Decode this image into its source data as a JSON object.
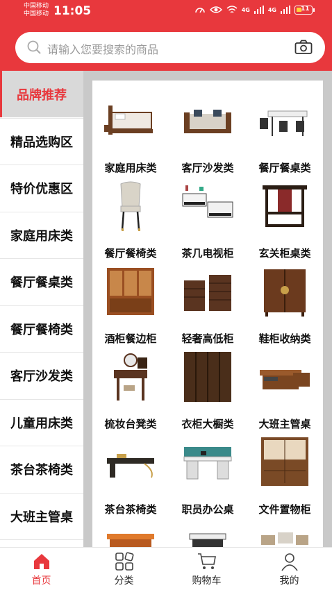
{
  "status": {
    "carrier1": "中国移动",
    "carrier2": "中国移动",
    "time": "11:05",
    "net1": "4G",
    "net2": "4G",
    "battery": "11"
  },
  "search": {
    "placeholder": "请输入您要搜索的商品"
  },
  "sidebar": {
    "items": [
      {
        "label": "品牌推荐",
        "active": true
      },
      {
        "label": "精品选购区"
      },
      {
        "label": "特价优惠区"
      },
      {
        "label": "家庭用床类"
      },
      {
        "label": "餐厅餐桌类"
      },
      {
        "label": "餐厅餐椅类"
      },
      {
        "label": "客厅沙发类"
      },
      {
        "label": "儿童用床类"
      },
      {
        "label": "茶台茶椅类"
      },
      {
        "label": "大班主管桌"
      },
      {
        "label": ""
      }
    ]
  },
  "products": [
    {
      "label": "家庭用床类",
      "icon": "bed-icon"
    },
    {
      "label": "客厅沙发类",
      "icon": "sofa-icon"
    },
    {
      "label": "餐厅餐桌类",
      "icon": "dining-table-icon"
    },
    {
      "label": "餐厅餐椅类",
      "icon": "chair-icon"
    },
    {
      "label": "茶几电视柜",
      "icon": "tv-cabinet-icon"
    },
    {
      "label": "玄关柜桌类",
      "icon": "console-icon"
    },
    {
      "label": "酒柜餐边柜",
      "icon": "wine-cabinet-icon"
    },
    {
      "label": "轻奢高低柜",
      "icon": "drawer-chest-icon"
    },
    {
      "label": "鞋柜收纳类",
      "icon": "shoe-cabinet-icon"
    },
    {
      "label": "梳妆台凳类",
      "icon": "dresser-icon"
    },
    {
      "label": "衣柜大橱类",
      "icon": "wardrobe-icon"
    },
    {
      "label": "大班主管桌",
      "icon": "executive-desk-icon"
    },
    {
      "label": "茶台茶椅类",
      "icon": "tea-table-icon"
    },
    {
      "label": "职员办公桌",
      "icon": "office-desk-icon"
    },
    {
      "label": "文件置物柜",
      "icon": "file-cabinet-icon"
    },
    {
      "label": "",
      "icon": "reception-desk-icon"
    },
    {
      "label": "",
      "icon": "coffee-table-icon"
    },
    {
      "label": "",
      "icon": "living-room-icon"
    }
  ],
  "tabs": [
    {
      "label": "首页",
      "icon": "home-icon",
      "active": true
    },
    {
      "label": "分类",
      "icon": "category-icon"
    },
    {
      "label": "购物车",
      "icon": "cart-icon"
    },
    {
      "label": "我的",
      "icon": "profile-icon"
    }
  ],
  "colors": {
    "accent": "#e8383d",
    "wood": "#6b3f22"
  }
}
